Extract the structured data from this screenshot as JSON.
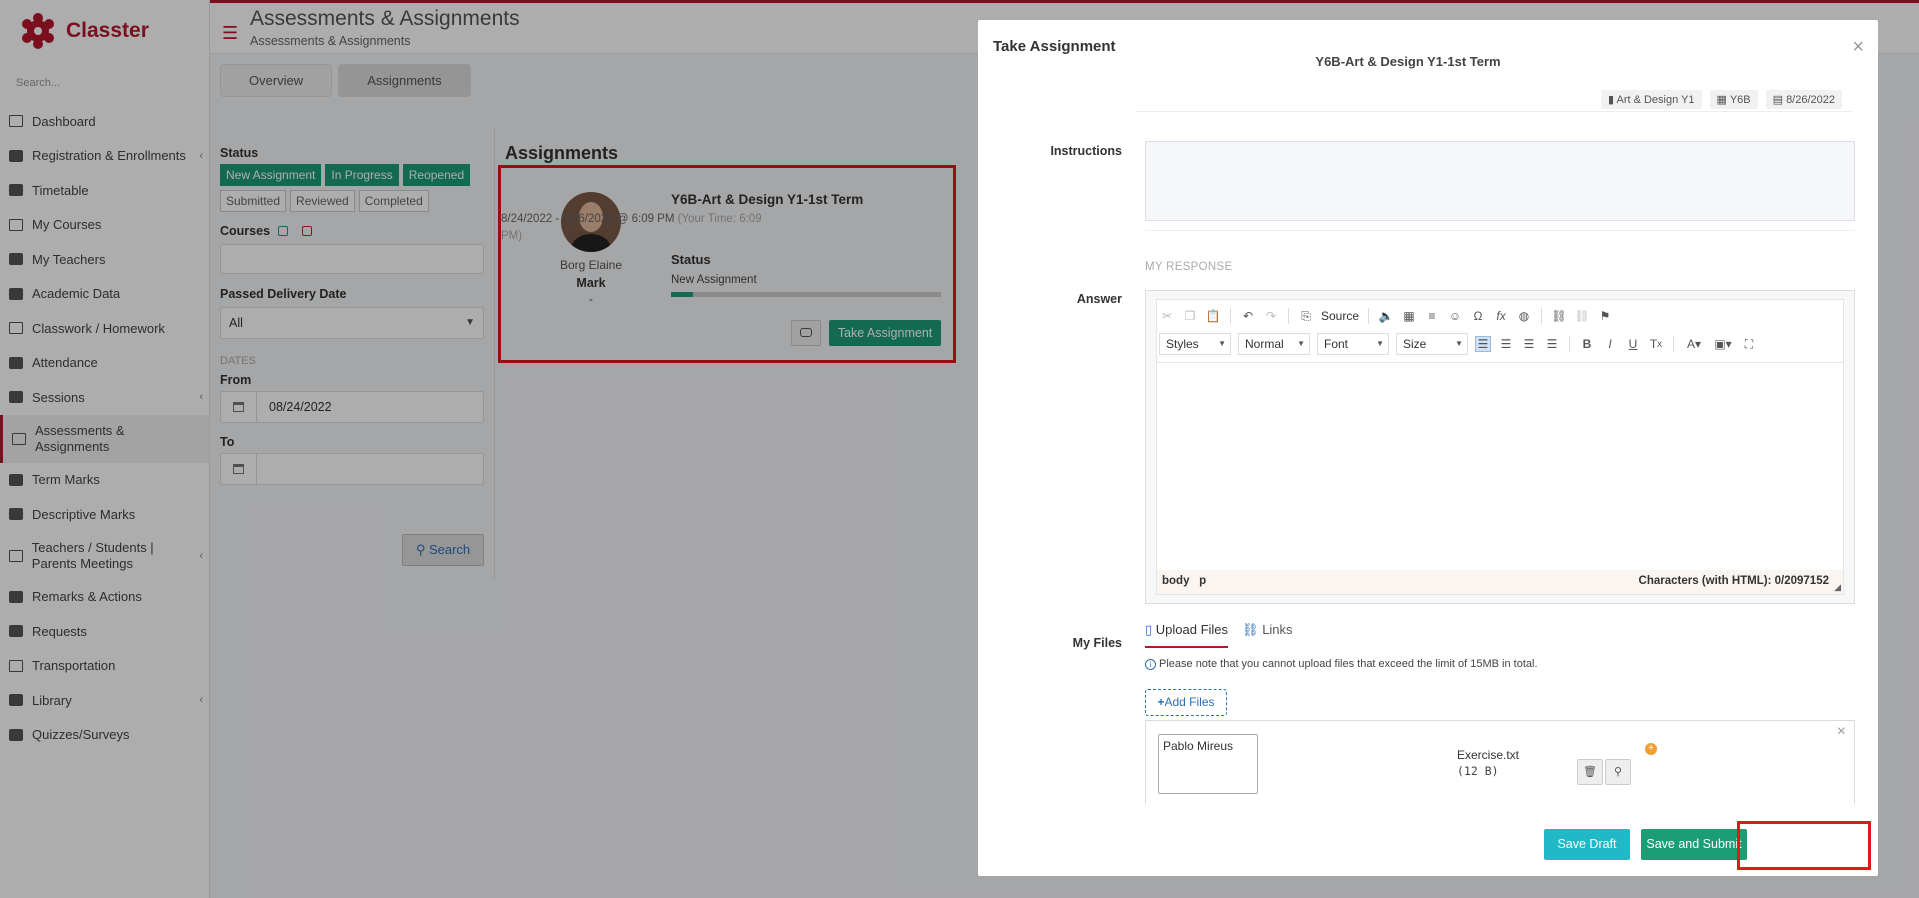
{
  "brand": {
    "name": "Classter",
    "color": "#b5172d"
  },
  "sidebar": {
    "search_placeholder": "Search...",
    "items": [
      {
        "label": "Dashboard",
        "icon": "monitor-icon"
      },
      {
        "label": "Registration & Enrollments",
        "icon": "institution-icon",
        "chevron": "‹"
      },
      {
        "label": "Timetable",
        "icon": "calendar-icon"
      },
      {
        "label": "My Courses",
        "icon": "book-icon"
      },
      {
        "label": "My Teachers",
        "icon": "users-icon"
      },
      {
        "label": "Academic Data",
        "icon": "id-card-icon"
      },
      {
        "label": "Classwork / Homework",
        "icon": "list-icon"
      },
      {
        "label": "Attendance",
        "icon": "user-check-icon"
      },
      {
        "label": "Sessions",
        "icon": "layers-icon",
        "chevron": "‹"
      },
      {
        "label": "Assessments & Assignments",
        "icon": "edit-icon"
      },
      {
        "label": "Term Marks",
        "icon": "grade-book-icon"
      },
      {
        "label": "Descriptive Marks",
        "icon": "chart-icon"
      },
      {
        "label": "Teachers / Students | Parents Meetings",
        "icon": "meeting-icon",
        "chevron": "‹"
      },
      {
        "label": "Remarks & Actions",
        "icon": "shuffle-icon"
      },
      {
        "label": "Requests",
        "icon": "file-icon"
      },
      {
        "label": "Transportation",
        "icon": "bus-icon"
      },
      {
        "label": "Library",
        "icon": "library-icon",
        "chevron": "‹"
      },
      {
        "label": "Quizzes/Surveys",
        "icon": "quiz-icon"
      }
    ]
  },
  "header": {
    "title": "Assessments & Assignments",
    "subtitle": "Assessments & Assignments"
  },
  "tabs": [
    {
      "label": "Overview"
    },
    {
      "label": "Assignments"
    }
  ],
  "filters": {
    "status_label": "Status",
    "statuses": [
      {
        "label": "New Assignment",
        "selected": true
      },
      {
        "label": "In Progress",
        "selected": true
      },
      {
        "label": "Reopened",
        "selected": true
      },
      {
        "label": "Submitted",
        "selected": false
      },
      {
        "label": "Reviewed",
        "selected": false
      },
      {
        "label": "Completed",
        "selected": false
      }
    ],
    "courses_label": "Courses",
    "passed_label": "Passed Delivery Date",
    "passed_value": "All",
    "dates_label": "DATES",
    "from_label": "From",
    "from_value": "08/24/2022",
    "to_label": "To",
    "to_value": "",
    "search_label": "Search"
  },
  "assignments": {
    "heading": "Assignments",
    "card": {
      "teacher": "Borg Elaine",
      "mark_label": "Mark",
      "mark_value": "-",
      "title": "Y6B-Art & Design Y1-1st Term",
      "dates": "8/24/2022 - 8/26/2022 @ 6:09 PM",
      "your_time": "(Your Time: 6:09 PM)",
      "status_label": "Status",
      "status_value": "New Assignment",
      "progress": 0.08,
      "take_label": "Take Assignment"
    }
  },
  "modal": {
    "title": "Take Assignment",
    "subtitle": "Y6B-Art & Design Y1-1st Term",
    "close": "×",
    "tags": {
      "course": "Art & Design Y1",
      "class": "Y6B",
      "date": "8/26/2022"
    },
    "instructions_label": "Instructions",
    "my_response": "MY RESPONSE",
    "answer_label": "Answer",
    "editor": {
      "source_label": "Source",
      "styles": "Styles",
      "normal": "Normal",
      "font": "Font",
      "size": "Size",
      "path_body": "body",
      "path_p": "p",
      "count": "Characters (with HTML): 0/2097152"
    },
    "files_label": "My Files",
    "upload_tab": "Upload Files",
    "links_tab": "Links",
    "note": "Please note that you cannot upload files that exceed the limit of 15MB in total.",
    "add_files": "Add Files",
    "file": {
      "note_value": "Pablo Mireus",
      "name": "Exercise.txt",
      "size": "(12 B)"
    },
    "save_draft": "Save Draft",
    "save_submit": "Save and Submit"
  },
  "colors": {
    "green": "#1c9d76",
    "teal": "#21b8c7",
    "highlight": "#e31818"
  }
}
